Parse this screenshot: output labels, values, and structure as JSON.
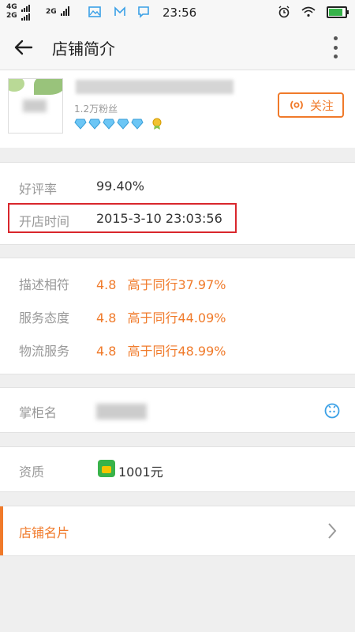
{
  "status_bar": {
    "net1": "4G",
    "net2": "2G",
    "net3": "2G",
    "time": "23:56"
  },
  "toolbar": {
    "title": "店铺简介"
  },
  "shop": {
    "fans": "1.2万粉丝",
    "diamond_count": 5,
    "follow_label": "关注"
  },
  "colors": {
    "accent": "#f07a2a",
    "highlight_border": "#d9262c",
    "diamond": "#4fb8f0"
  },
  "basic_info": [
    {
      "label": "好评率",
      "value": "99.40%"
    },
    {
      "label": "开店时间",
      "value": "2015-3-10 23:03:56"
    }
  ],
  "ratings": [
    {
      "label": "描述相符",
      "score": "4.8",
      "compare": "高于同行37.97%"
    },
    {
      "label": "服务态度",
      "score": "4.8",
      "compare": "高于同行44.09%"
    },
    {
      "label": "物流服务",
      "score": "4.8",
      "compare": "高于同行48.99%"
    }
  ],
  "owner": {
    "label": "掌柜名"
  },
  "qualification": {
    "label": "资质",
    "value": "1001元"
  },
  "shop_card": {
    "label": "店铺名片"
  }
}
